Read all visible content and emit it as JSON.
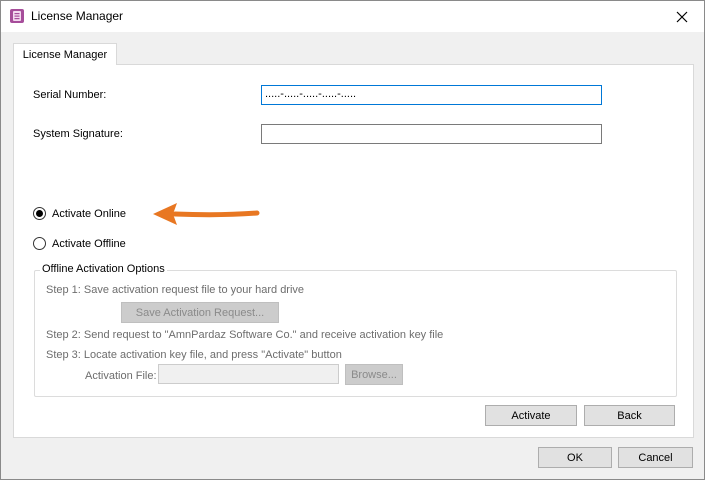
{
  "window": {
    "title": "License Manager",
    "close_icon": "close-icon",
    "app_icon": "license-manager-app-icon"
  },
  "tab": {
    "label": "License Manager"
  },
  "form": {
    "serial_label": "Serial Number:",
    "serial_value": ".....-.....-.....-.....-.....",
    "signature_label": "System Signature:",
    "signature_value": ""
  },
  "activation": {
    "online_label": "Activate Online",
    "offline_label": "Activate Offline",
    "selected": "online"
  },
  "offline_options": {
    "legend": "Offline Activation Options",
    "step1": "Step 1: Save activation request file to your hard drive",
    "save_request_button": "Save Activation Request...",
    "step2": "Step 2: Send request to \"AmnPardaz Software Co.\" and receive activation key file",
    "step3": "Step 3: Locate activation key file, and press \"Activate\" button",
    "activation_file_label": "Activation File:",
    "activation_file_value": "",
    "browse_button": "Browse..."
  },
  "panel_buttons": {
    "activate": "Activate",
    "back": "Back"
  },
  "dialog_buttons": {
    "ok": "OK",
    "cancel": "Cancel"
  },
  "colors": {
    "accent_focus": "#0078d7",
    "annotation_arrow": "#e87722",
    "app_icon": "#a64d9a"
  }
}
